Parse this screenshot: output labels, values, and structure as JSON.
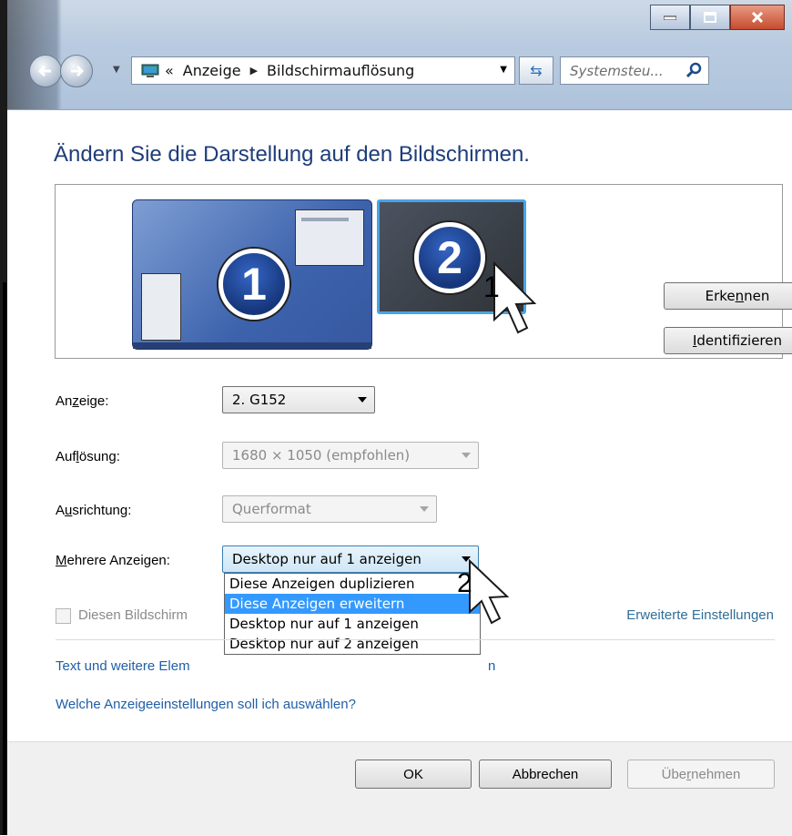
{
  "window": {
    "controls": [
      "minimize",
      "maximize",
      "close"
    ]
  },
  "address_bar": {
    "prefix": "«",
    "crumbs": [
      "Anzeige",
      "Bildschirmauflösung"
    ],
    "search_placeholder": "Systemsteu..."
  },
  "page": {
    "title": "Ändern Sie die Darstellung auf den Bildschirmen.",
    "monitors": [
      {
        "number": "1",
        "state": "primary"
      },
      {
        "number": "2",
        "state": "selected"
      }
    ],
    "callouts": [
      "1",
      "2"
    ],
    "buttons": {
      "detect": {
        "pre": "Erke",
        "accel": "n",
        "post": "nen"
      },
      "identify": {
        "pre": "",
        "accel": "I",
        "post": "dentifizieren"
      }
    }
  },
  "form": {
    "display": {
      "label_pre": "An",
      "label_accel": "z",
      "label_post": "eige:",
      "value": "2. G152"
    },
    "resolution": {
      "label_pre": "Auf",
      "label_accel": "l",
      "label_post": "ösung:",
      "value": "1680 × 1050 (empfohlen)",
      "enabled": false
    },
    "orientation": {
      "label_pre": "A",
      "label_accel": "u",
      "label_post": "srichtung:",
      "value": "Querformat",
      "enabled": false
    },
    "multiple": {
      "label_pre": "",
      "label_accel": "M",
      "label_post": "ehrere Anzeigen:",
      "value": "Desktop nur auf 1 anzeigen",
      "options": [
        "Diese Anzeigen duplizieren",
        "Diese Anzeigen erweitern",
        "Desktop nur auf 1 anzeigen",
        "Desktop nur auf 2 anzeigen"
      ],
      "highlighted_index": 1
    },
    "primary_checkbox_label": "Diesen Bildschirm",
    "advanced_link": "Erweiterte Einstellungen"
  },
  "links": {
    "text_size": "Text und weitere Elem",
    "text_size_tail": "n",
    "which_settings": "Welche Anzeigeeinstellungen soll ich auswählen?"
  },
  "footer": {
    "ok": "OK",
    "cancel": "Abbrechen",
    "apply": {
      "pre": "Übe",
      "accel": "r",
      "post": "nehmen",
      "enabled": false
    }
  },
  "colors": {
    "title": "#1e3d7a",
    "link": "#1f5fa8",
    "highlight": "#3399ff",
    "monitor_selected_border": "#4aa3e6"
  }
}
